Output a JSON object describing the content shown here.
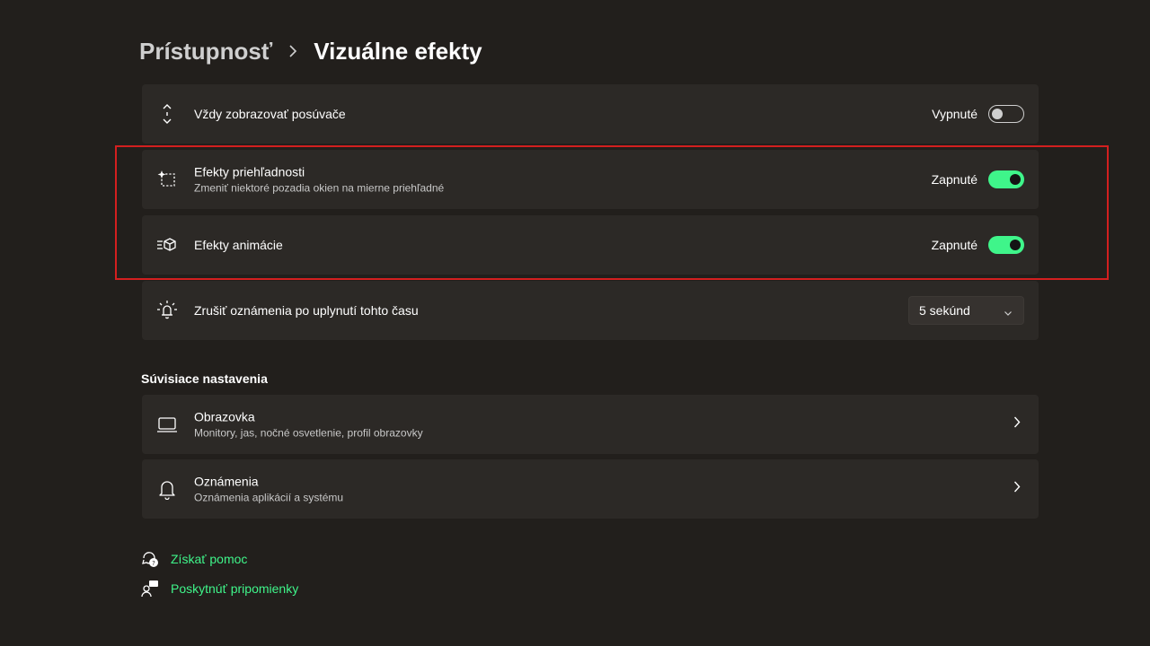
{
  "breadcrumb": {
    "parent": "Prístupnosť",
    "current": "Vizuálne efekty"
  },
  "settings": [
    {
      "title": "Vždy zobrazovať posúvače",
      "subtitle": "",
      "icon": "scrollbar-arrows-icon",
      "state_label": "Vypnuté",
      "toggle_on": false
    },
    {
      "title": "Efekty priehľadnosti",
      "subtitle": "Zmeniť niektoré pozadia okien na mierne priehľadné",
      "icon": "transparency-sparkle-icon",
      "state_label": "Zapnuté",
      "toggle_on": true
    },
    {
      "title": "Efekty animácie",
      "subtitle": "",
      "icon": "animation-cube-icon",
      "state_label": "Zapnuté",
      "toggle_on": true
    },
    {
      "title": "Zrušiť oznámenia po uplynutí tohto času",
      "subtitle": "",
      "icon": "notification-timer-icon",
      "dropdown_value": "5 sekúnd"
    }
  ],
  "related": {
    "heading": "Súvisiace nastavenia",
    "items": [
      {
        "title": "Obrazovka",
        "subtitle": "Monitory, jas, nočné osvetlenie, profil obrazovky",
        "icon": "laptop-display-icon"
      },
      {
        "title": "Oznámenia",
        "subtitle": "Oznámenia aplikácií a systému",
        "icon": "bell-icon"
      }
    ]
  },
  "links": [
    {
      "label": "Získať pomoc",
      "icon": "help-chat-icon"
    },
    {
      "label": "Poskytnúť pripomienky",
      "icon": "feedback-person-icon"
    }
  ],
  "colors": {
    "accent": "#3ff58a",
    "background": "#221f1c",
    "card": "#2c2926",
    "highlight_box": "#d31f1f"
  }
}
